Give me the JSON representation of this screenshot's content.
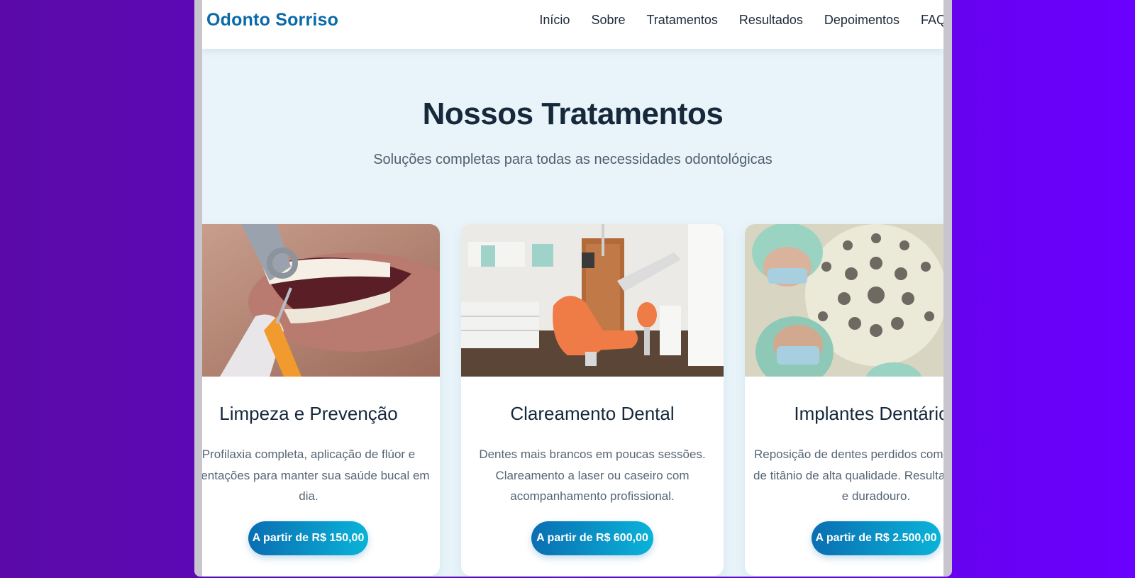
{
  "brand": "Odonto Sorriso",
  "nav": [
    "Início",
    "Sobre",
    "Tratamentos",
    "Resultados",
    "Depoimentos",
    "FAQ"
  ],
  "section": {
    "title": "Nossos Tratamentos",
    "subtitle": "Soluções completas para todas as necessidades odontológicas"
  },
  "cards": [
    {
      "title": "Limpeza e Prevenção",
      "description": "Profilaxia completa, aplicação de flúor e orientações para manter sua saúde bucal em dia.",
      "price": "A partir de R$ 150,00"
    },
    {
      "title": "Clareamento Dental",
      "description": "Dentes mais brancos em poucas sessões. Clareamento a laser ou caseiro com acompanhamento profissional.",
      "price": "A partir de R$ 600,00"
    },
    {
      "title": "Implantes Dentários",
      "description": "Reposição de dentes perdidos com implantes de titânio de alta qualidade. Resultado natural e duradouro.",
      "price": "A partir de R$ 2.500,00"
    }
  ],
  "colors": {
    "background_gradient": [
      "#5b0aa8",
      "#6a00ff"
    ],
    "brand": "#0a6aa8",
    "button_gradient": [
      "#0a6eb2",
      "#0ab3d8"
    ],
    "section_bg": "#e8f4f9"
  }
}
